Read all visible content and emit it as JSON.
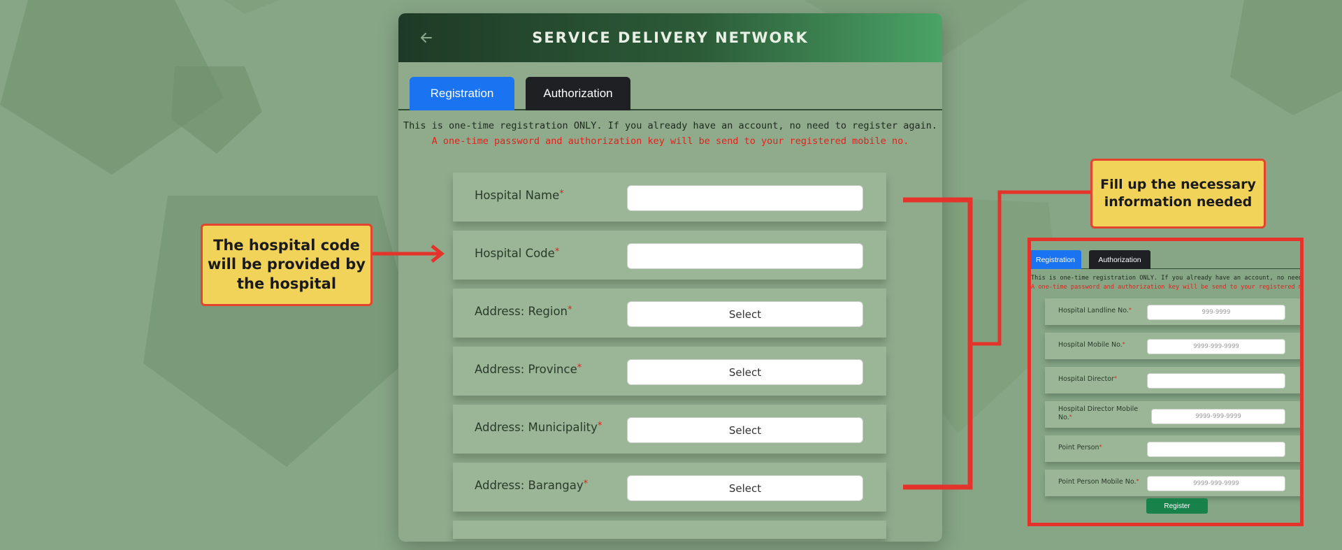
{
  "header": {
    "title": "SERVICE DELIVERY NETWORK",
    "back_icon": "arrow-left-icon"
  },
  "tabs": [
    {
      "label": "Registration",
      "active": true,
      "color": "#1a73f0"
    },
    {
      "label": "Authorization",
      "active": false,
      "color": "#1f2024"
    }
  ],
  "notice": {
    "line1": "This is one-time registration ONLY. If you already have an account, no need to register again.",
    "line2": "A one-time password and authorization key will be send to your registered mobile no."
  },
  "form": {
    "required_mark": "*",
    "fields": [
      {
        "label": "Hospital Name",
        "value": ""
      },
      {
        "label": "Hospital Code",
        "value": ""
      },
      {
        "label": "Address: Region",
        "value": "Select"
      },
      {
        "label": "Address: Province",
        "value": "Select"
      },
      {
        "label": "Address: Municipality",
        "value": "Select"
      },
      {
        "label": "Address: Barangay",
        "value": "Select"
      }
    ]
  },
  "callouts": {
    "left": "The hospital code will be provided by the hospital",
    "right": "Fill up the necessary information needed"
  },
  "inset": {
    "tabs": [
      "Registration",
      "Authorization"
    ],
    "notice_line1": "This is one-time registration ONLY. If you already have an account, no need to register a",
    "notice_line2": "A one-time password and authorization key will be send to your registered mobile no.",
    "fields": [
      {
        "label": "Hospital Landline No.",
        "placeholder": "999-9999"
      },
      {
        "label": "Hospital Mobile No.",
        "placeholder": "9999-999-9999"
      },
      {
        "label": "Hospital Director",
        "placeholder": ""
      },
      {
        "label": "Hospital Director Mobile No.",
        "placeholder": "9999-999-9999"
      },
      {
        "label": "Point Person",
        "placeholder": ""
      },
      {
        "label": "Point Person Mobile No.",
        "placeholder": "9999-999-9999"
      }
    ],
    "register_label": "Register"
  },
  "colors": {
    "background": "#87a686",
    "accent_red": "#e4332a",
    "callout_yellow": "#f2d35a",
    "register_green": "#17824a"
  }
}
